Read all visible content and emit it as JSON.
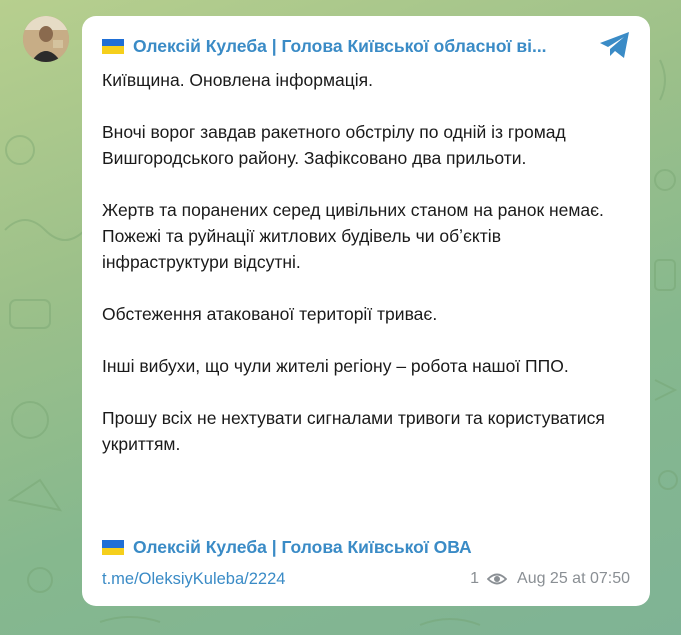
{
  "background": {
    "color": "#9cc08a"
  },
  "avatar": {
    "icon": "person-avatar"
  },
  "post": {
    "channel_name": "Олексій Кулеба | Голова Київської обласної ві...",
    "flag_icon": "ukraine-flag-icon",
    "share_icon": "telegram-plane-icon",
    "paragraphs": [
      "Київщина. Оновлена інформація.",
      "Вночі ворог завдав ракетного обстрілу по одній із громад Вишгородського району. Зафіксовано два прильоти.",
      "Жертв та поранених серед цивільних станом на ранок немає. Пожежі та руйнації житлових будівель чи обʼєктів інфраструктури відсутні.",
      "Обстеження атакованої території триває.",
      "Інші вибухи, що чули жителі регіону – робота нашої ППО.",
      "Прошу всіх не нехтувати сигналами тривоги та користуватися укриттям."
    ],
    "signature": "Олексій Кулеба | Голова Київської ОВА",
    "link": "t.me/OleksiyKuleba/2224",
    "views": "1",
    "date": "Aug 25 at 07:50"
  },
  "colors": {
    "link": "#3a8bc6",
    "flag_blue": "#1f6fd6",
    "flag_yellow": "#f5cf1c",
    "meta": "#8a8f94"
  }
}
